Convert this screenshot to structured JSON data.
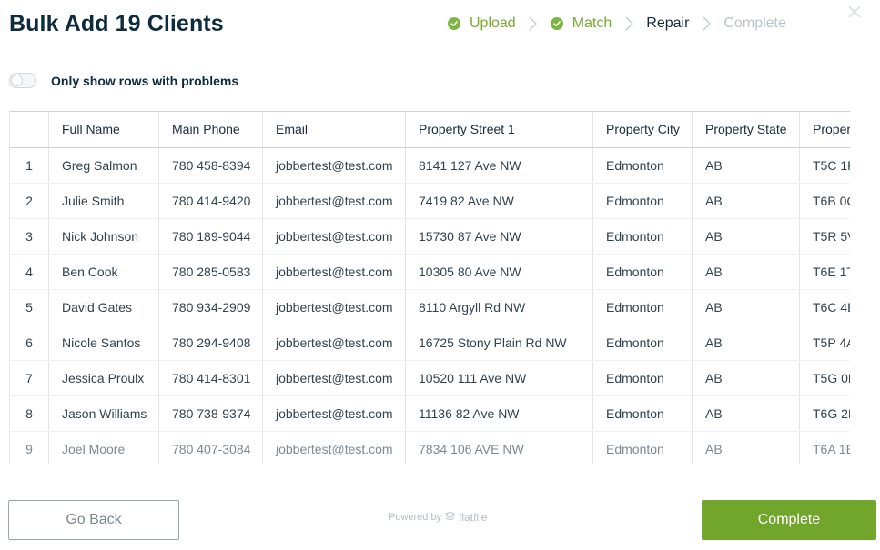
{
  "title": "Bulk Add 19 Clients",
  "steps": [
    {
      "label": "Upload",
      "state": "done"
    },
    {
      "label": "Match",
      "state": "done"
    },
    {
      "label": "Repair",
      "state": "current"
    },
    {
      "label": "Complete",
      "state": "pending"
    }
  ],
  "toggle": {
    "label": "Only show rows with problems",
    "on": false
  },
  "table": {
    "columns": [
      "",
      "Full Name",
      "Main Phone",
      "Email",
      "Property Street 1",
      "Property City",
      "Property State",
      "Proper"
    ],
    "rows": [
      [
        "1",
        "Greg Salmon",
        "780 458-8394",
        "jobbertest@test.com",
        "8141 127 Ave NW",
        "Edmonton",
        "AB",
        "T5C 1F"
      ],
      [
        "2",
        "Julie Smith",
        "780 414-9420",
        "jobbertest@test.com",
        "7419 82 Ave NW",
        "Edmonton",
        "AB",
        "T6B 0C"
      ],
      [
        "3",
        "Nick Johnson",
        "780 189-9044",
        "jobbertest@test.com",
        "15730 87 Ave NW",
        "Edmonton",
        "AB",
        "T5R 5V"
      ],
      [
        "4",
        "Ben Cook",
        "780 285-0583",
        "jobbertest@test.com",
        "10305 80 Ave NW",
        "Edmonton",
        "AB",
        "T6E 1T"
      ],
      [
        "5",
        "David Gates",
        "780 934-2909",
        "jobbertest@test.com",
        "8110 Argyll Rd NW",
        "Edmonton",
        "AB",
        "T6C 4E"
      ],
      [
        "6",
        "Nicole Santos",
        "780 294-9408",
        "jobbertest@test.com",
        "16725 Stony Plain Rd NW",
        "Edmonton",
        "AB",
        "T5P 4A"
      ],
      [
        "7",
        "Jessica Proulx",
        "780 414-8301",
        "jobbertest@test.com",
        "10520 111 Ave NW",
        "Edmonton",
        "AB",
        "T5G 0E"
      ],
      [
        "8",
        "Jason Williams",
        "780 738-9374",
        "jobbertest@test.com",
        "11136 82 Ave NW",
        "Edmonton",
        "AB",
        "T6G 2I"
      ],
      [
        "9",
        "Joel Moore",
        "780 407-3084",
        "jobbertest@test.com",
        "7834 106 AVE NW",
        "Edmonton",
        "AB",
        "T6A 1E"
      ]
    ]
  },
  "footer": {
    "back_label": "Go Back",
    "powered_by": "Powered by",
    "brand": "flatfile",
    "complete_label": "Complete"
  },
  "colors": {
    "accent": "#72a52c",
    "done": "#7aa830",
    "pending": "#b9c3cc"
  },
  "icons": {
    "step_done": "check-circle-icon",
    "separator": "chevron-right-icon",
    "close": "close-icon",
    "brand": "flatfile-logo-icon"
  }
}
